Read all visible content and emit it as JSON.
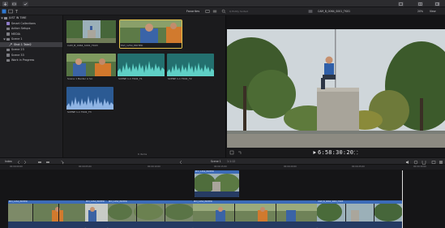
{
  "colors": {
    "accent_blue": "#2f79d3",
    "selection_yellow": "#e3c14c",
    "timeline_clip_blue": "#3c6bb8",
    "audio_teal": "#2aa39d",
    "audio_blue": "#3f6fb0"
  },
  "topbar": {
    "icons": [
      "import-icon",
      "keys-icon",
      "check-icon",
      "library-icon",
      "browser-icon",
      "inspector-icon"
    ]
  },
  "toolbar2": {
    "filter_label": "Favorites",
    "search_placeholder": "Q Entity Sorted",
    "viewer_clip_name": "CAM_B_0064_S001_TK01",
    "zoom_label": "20%",
    "view_label": "View"
  },
  "sidebar": {
    "items": [
      {
        "label": "JUST IN TIME",
        "icon": "library-icon",
        "depth": 0
      },
      {
        "label": "Smart Collections",
        "icon": "folder-icon",
        "depth": 1
      },
      {
        "label": "Action Setups",
        "icon": "event-icon",
        "depth": 1
      },
      {
        "label": "MEDIA",
        "icon": "event-icon",
        "depth": 1
      },
      {
        "label": "Scene 1",
        "icon": "event-icon",
        "depth": 1
      },
      {
        "label": "Shot 1 Take2",
        "icon": "keyword-icon",
        "depth": 2,
        "selected": true
      },
      {
        "label": "Scene 23",
        "icon": "event-icon",
        "depth": 1
      },
      {
        "label": "Scene 33",
        "icon": "event-icon",
        "depth": 1
      },
      {
        "label": "Work in Progress",
        "icon": "event-icon",
        "depth": 1
      }
    ]
  },
  "browser": {
    "clips": [
      {
        "name": "CAM_B_0064_S001_TK03",
        "kind": "video"
      },
      {
        "name": "MVI_1254_EDITED",
        "kind": "video"
      },
      {
        "name": "Scene 1 Banter A Sci",
        "kind": "video"
      },
      {
        "name": "SCENE 1-1 TK02_T1",
        "kind": "audio"
      },
      {
        "name": "SCENE 1-1 TK02_T2",
        "kind": "audio"
      },
      {
        "name": "SCENE 1-1 TK02_T3",
        "kind": "audio"
      }
    ],
    "count_label": "6 items"
  },
  "viewer": {
    "timecode": "6:58:30:20"
  },
  "timeline": {
    "index_label": "Index",
    "project_label": "Scene 1",
    "duration_label": "1:1:12",
    "ruler_ticks": [
      "00:00:00:00",
      "00:00:05:00",
      "00:00:10:00",
      "00:00:15:00",
      "00:00:20:00",
      "00:00:25:00",
      "00:00:30:00",
      "00:00:35:00",
      "00:00:40:00"
    ],
    "clips": [
      {
        "name": "MVI_1254_EDITED",
        "lane": "connected"
      },
      {
        "name": "MVI_1254_EDITED",
        "lane": "primary"
      },
      {
        "name": "MVI_1254_EDITED",
        "lane": "primary"
      },
      {
        "name": "MVI_1254_EDITED",
        "lane": "primary"
      },
      {
        "name": "CAM_B_0064_S001_TK03",
        "lane": "primary"
      }
    ]
  }
}
